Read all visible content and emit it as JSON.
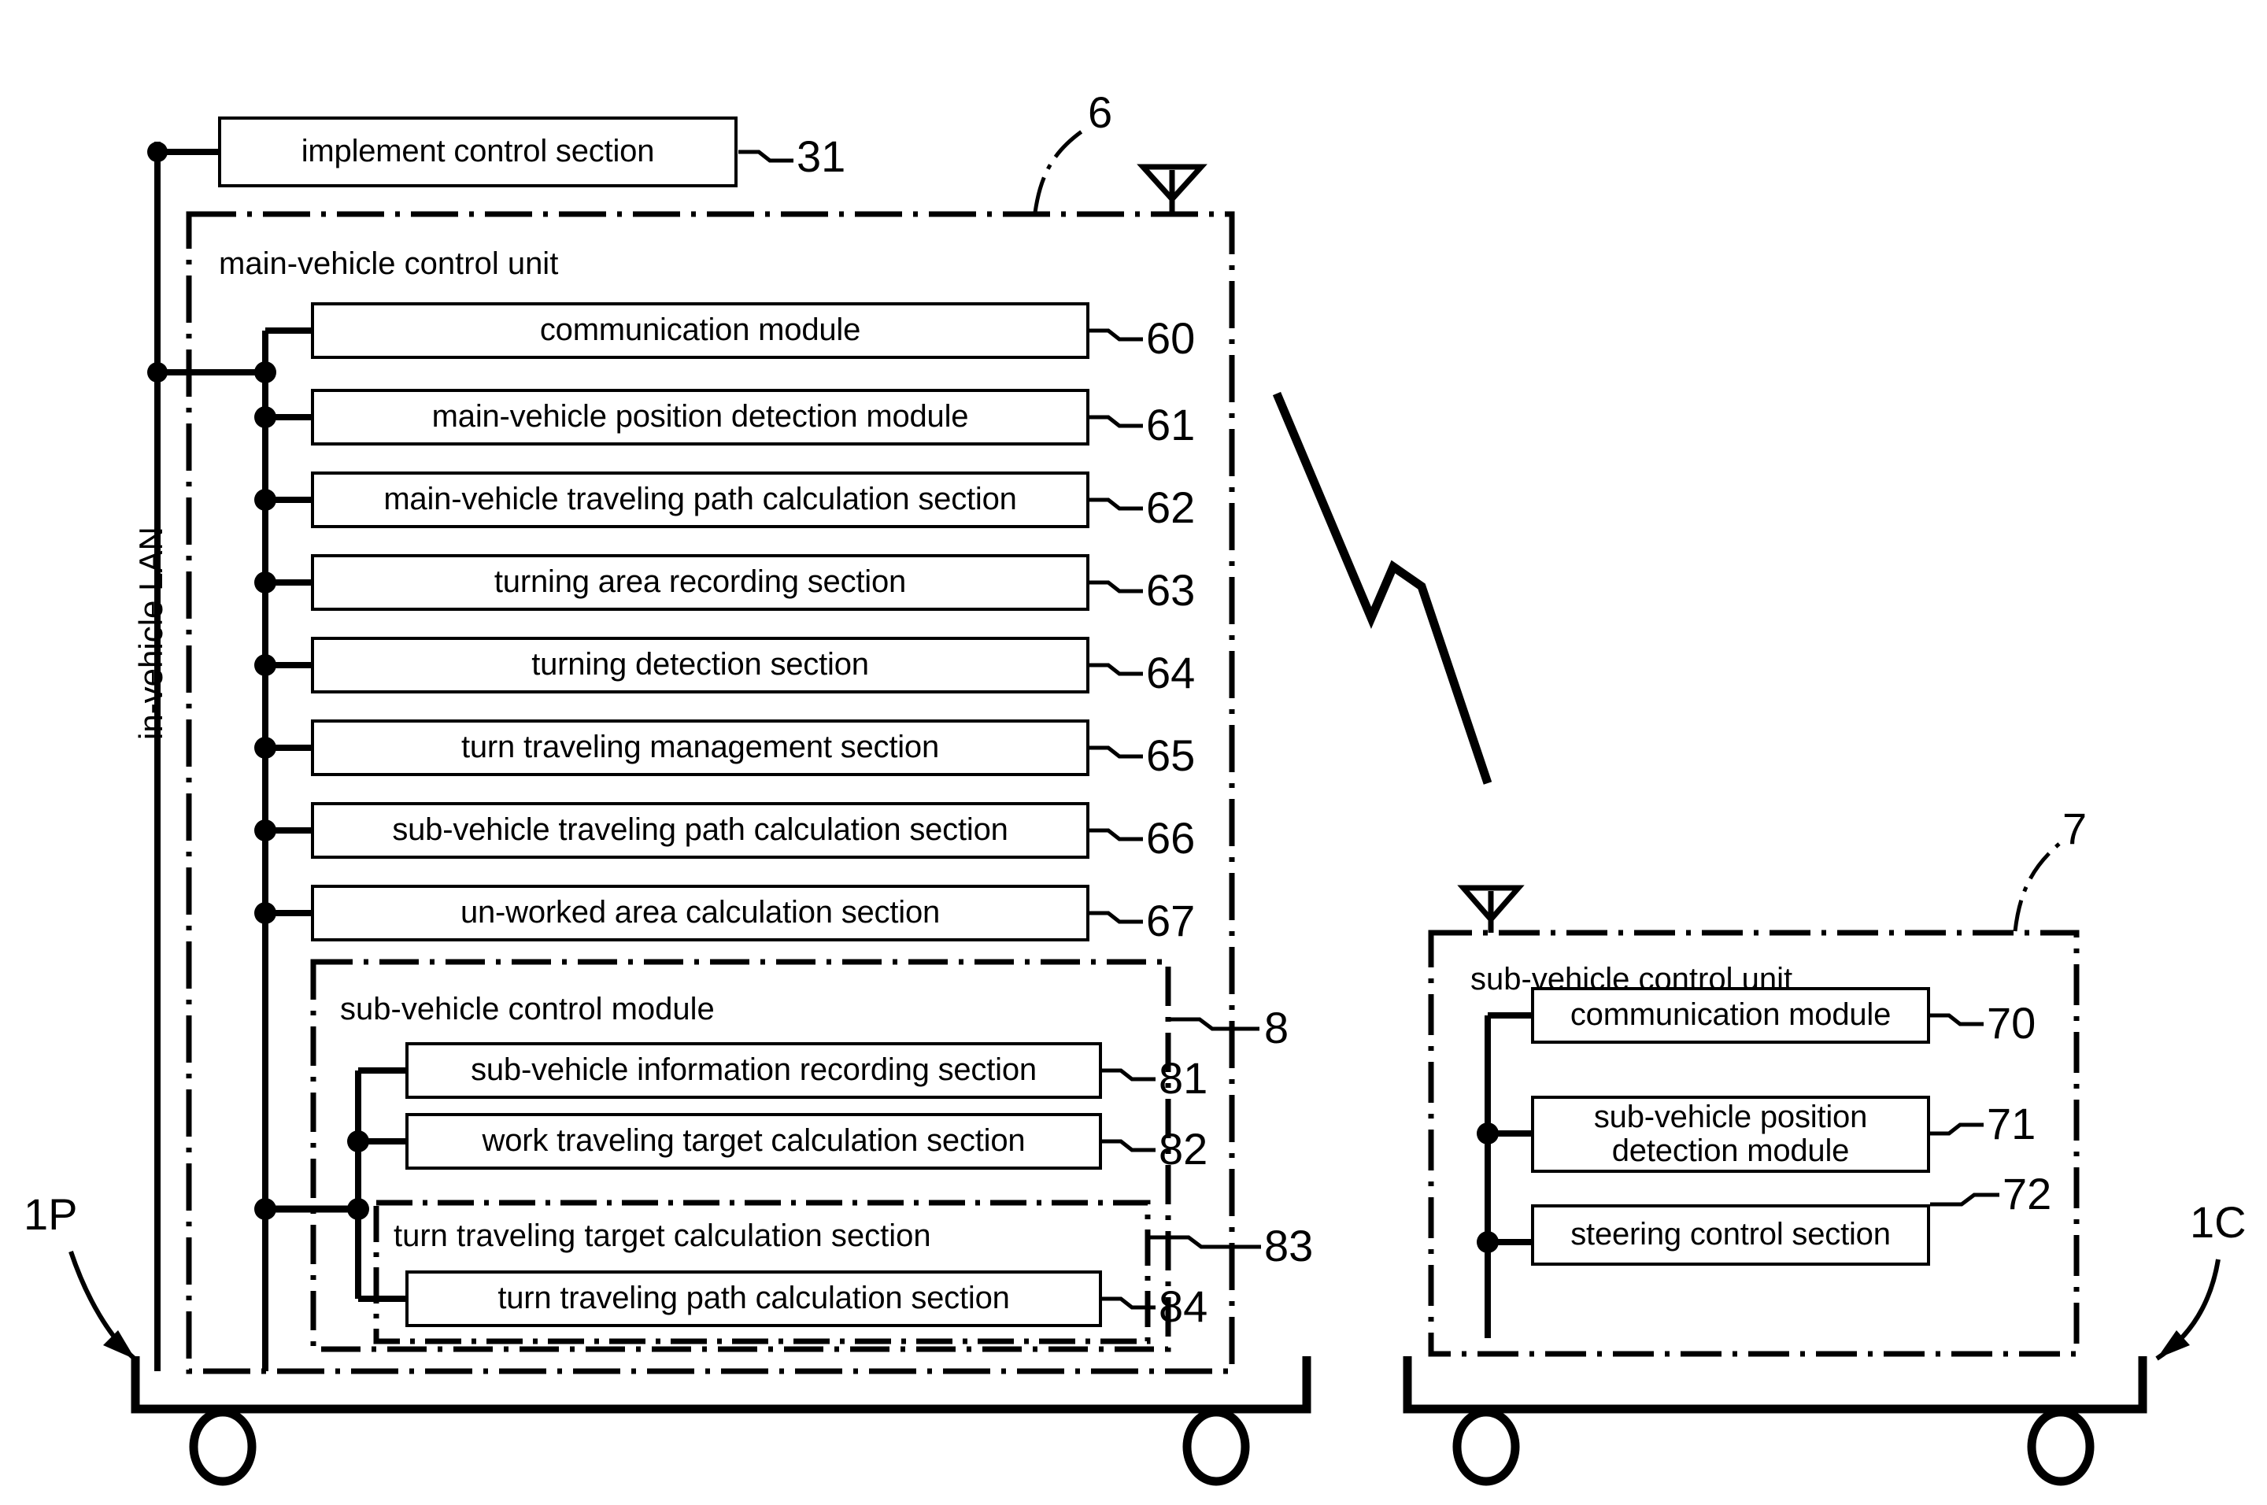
{
  "diagram": {
    "title_visible": false,
    "left_bus_label": "in-vehicle LAN",
    "main_unit_label": "main-vehicle control unit",
    "sub_module_label": "sub-vehicle control module",
    "sub_unit_label": "sub-vehicle control unit",
    "implement_box": "implement control section"
  },
  "main_modules": [
    {
      "label": "communication module",
      "ref": "60"
    },
    {
      "label": "main-vehicle position detection module",
      "ref": "61"
    },
    {
      "label": "main-vehicle traveling path calculation section",
      "ref": "62"
    },
    {
      "label": "turning area recording section",
      "ref": "63"
    },
    {
      "label": "turning detection section",
      "ref": "64"
    },
    {
      "label": "turn traveling management section",
      "ref": "65"
    },
    {
      "label": "sub-vehicle traveling path calculation section",
      "ref": "66"
    },
    {
      "label": "un-worked area calculation section",
      "ref": "67"
    }
  ],
  "sub_control_module": {
    "ref": "8",
    "items": [
      {
        "label": "sub-vehicle information recording section",
        "ref": "81"
      },
      {
        "label": "work traveling target calculation section",
        "ref": "82"
      }
    ],
    "turn_target": {
      "label": "turn traveling target calculation section",
      "ref": "83",
      "inner": {
        "label": "turn traveling path calculation section",
        "ref": "84"
      }
    }
  },
  "sub_unit_modules": [
    {
      "label": "communication module",
      "ref": "70"
    },
    {
      "label": "sub-vehicle position\ndetection module",
      "ref": "71"
    },
    {
      "label": "steering control section",
      "ref": "72"
    }
  ],
  "refs": {
    "implement": "31",
    "main_unit": "6",
    "sub_unit": "7",
    "main_vehicle": "1P",
    "sub_vehicle": "1C"
  },
  "colors": {
    "ink": "#000000",
    "paper": "#ffffff"
  }
}
